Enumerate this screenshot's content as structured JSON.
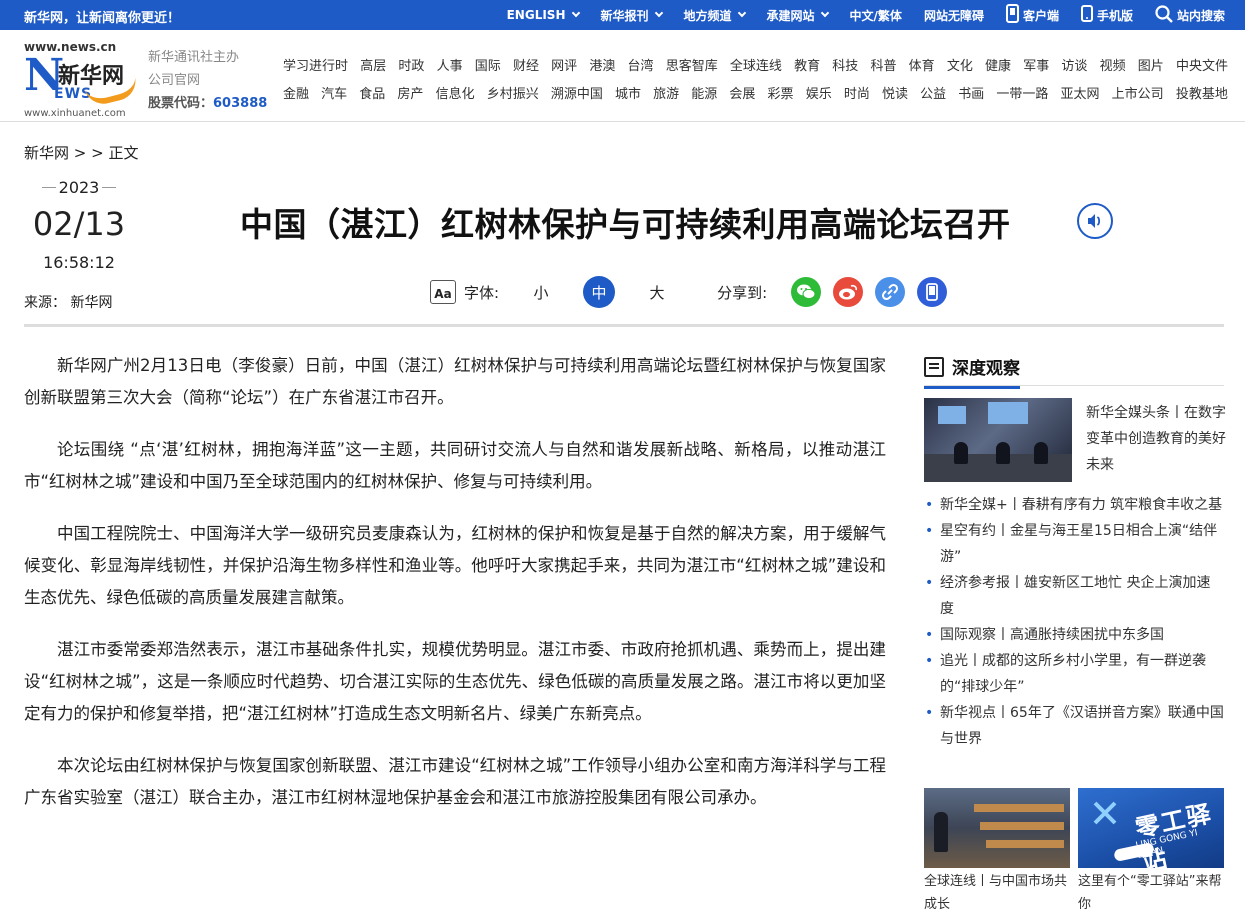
{
  "topbar": {
    "slogan": "新华网，让新闻离你更近！",
    "nav": [
      "ENGLISH",
      "新华报刊",
      "地方频道",
      "承建网站",
      "中文/繁体",
      "网站无障碍",
      "客户端",
      "手机版",
      "站内搜索"
    ]
  },
  "logo": {
    "url_top": "www.news.cn",
    "brand_cn": "新华网",
    "brand_en": "EWS",
    "url_bottom": "www.xinhuanet.com"
  },
  "org": {
    "line1": "新华通讯社主办",
    "line2": "公司官网",
    "stock_label": "股票代码：",
    "stock_code": "603888"
  },
  "catnav": {
    "row1": [
      "学习进行时",
      "高层",
      "时政",
      "人事",
      "国际",
      "财经",
      "网评",
      "港澳",
      "台湾",
      "思客智库",
      "全球连线",
      "教育",
      "科技",
      "科普",
      "体育",
      "文化",
      "健康",
      "军事",
      "访谈",
      "视频",
      "图片",
      "中央文件"
    ],
    "row2": [
      "金融",
      "汽车",
      "食品",
      "房产",
      "信息化",
      "乡村振兴",
      "溯源中国",
      "城市",
      "旅游",
      "能源",
      "会展",
      "彩票",
      "娱乐",
      "时尚",
      "悦读",
      "公益",
      "书画",
      "一带一路",
      "亚太网",
      "上市公司",
      "投教基地"
    ]
  },
  "breadcrumb": "新华网 > > 正文",
  "article": {
    "year": "2023",
    "month_day": "02/13",
    "time": "16:58:12",
    "source": "来源：  新华网",
    "title": "中国（湛江）红树林保护与可持续利用高端论坛召开",
    "font_label": "字体:",
    "font_sizes": [
      "小",
      "中",
      "大"
    ],
    "font_active": "中",
    "share_label": "分享到:",
    "paragraphs": [
      "新华网广州2月13日电（李俊豪）日前，中国（湛江）红树林保护与可持续利用高端论坛暨红树林保护与恢复国家创新联盟第三次大会（简称“论坛”）在广东省湛江市召开。",
      "论坛围绕 “点‘湛’红树林，拥抱海洋蓝”这一主题，共同研讨交流人与自然和谐发展新战略、新格局，以推动湛江市“红树林之城”建设和中国乃至全球范围内的红树林保护、修复与可持续利用。",
      "中国工程院院士、中国海洋大学一级研究员麦康森认为，红树林的保护和恢复是基于自然的解决方案，用于缓解气候变化、彰显海岸线韧性，并保护沿海生物多样性和渔业等。他呼吁大家携起手来，共同为湛江市“红树林之城”建设和生态优先、绿色低碳的高质量发展建言献策。",
      "湛江市委常委郑浩然表示，湛江市基础条件扎实，规模优势明显。湛江市委、市政府抢抓机遇、乘势而上，提出建设“红树林之城”，这是一条顺应时代趋势、切合湛江实际的生态优先、绿色低碳的高质量发展之路。湛江市将以更加坚定有力的保护和修复举措，把“湛江红树林”打造成生态文明新名片、绿美广东新亮点。",
      "本次论坛由红树林保护与恢复国家创新联盟、湛江市建设“红树林之城”工作领导小组办公室和南方海洋科学与工程广东省实验室（湛江）联合主办，湛江市红树林湿地保护基金会和湛江市旅游控股集团有限公司承办。"
    ]
  },
  "sidebar": {
    "heading": "深度观察",
    "feature_text": "新华全媒头条丨在数字变革中创造教育的美好未来",
    "items": [
      "新华全媒+丨春耕有序有力 筑牢粮食丰收之基",
      "星空有约丨金星与海王星15日相合上演“结伴游”",
      "经济参考报丨雄安新区工地忙 央企上演加速度",
      "国际观察丨高通胀持续困扰中东多国",
      "追光丨成都的这所乡村小学里，有一群逆袭的“排球少年”",
      "新华视点丨65年了《汉语拼音方案》联通中国与世界"
    ],
    "pics": [
      {
        "caption": "全球连线丨与中国市场共成长"
      },
      {
        "caption": "这里有个“零工驿站”来帮你",
        "img_text_big": "零工驿站",
        "img_text_small": "LING GONG YI ZHAN"
      }
    ]
  },
  "colors": {
    "brand_blue": "#1e5bc6",
    "logo_orange": "#f29b1d",
    "wechat": "#2dbb38",
    "weibo": "#e84a3c",
    "link": "#4a8fe8",
    "mobile": "#2f5ed8"
  },
  "icons": [
    "chevron-down-icon",
    "phone-icon",
    "mobile-icon",
    "search-icon",
    "speaker-icon",
    "font-size-icon",
    "wechat-icon",
    "weibo-icon",
    "link-icon",
    "mobile-share-icon",
    "book-icon"
  ]
}
